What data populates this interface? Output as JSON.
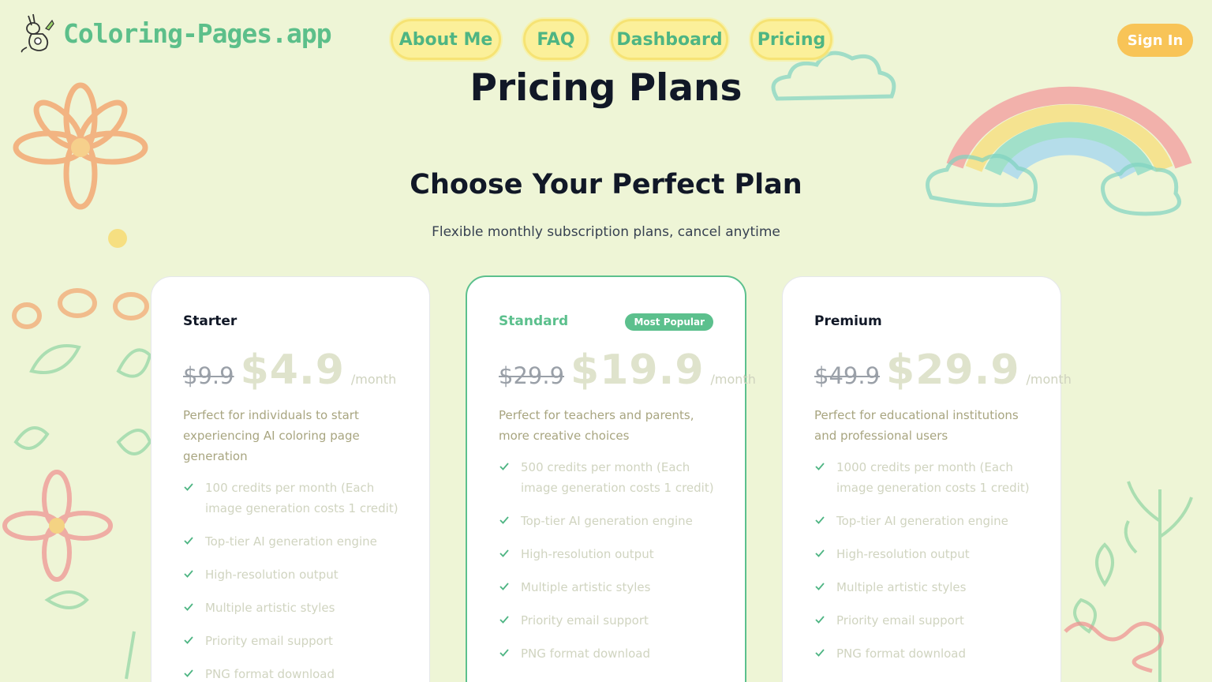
{
  "header": {
    "logo_text": "Coloring-Pages.app",
    "nav": [
      "About Me",
      "FAQ",
      "Dashboard",
      "Pricing"
    ],
    "sign_in": "Sign In"
  },
  "page_title": "Pricing Plans",
  "section": {
    "title": "Choose Your Perfect Plan",
    "subtitle": "Flexible monthly subscription plans, cancel anytime"
  },
  "plans": [
    {
      "name": "Starter",
      "old_price": "$9.9",
      "price": "$4.9",
      "period": "/month",
      "description": "Perfect for individuals to start experiencing AI coloring page generation",
      "features": [
        "100 credits per month (Each image generation costs 1 credit)",
        "Top-tier AI generation engine",
        "High-resolution output",
        "Multiple artistic styles",
        "Priority email support",
        "PNG format download"
      ]
    },
    {
      "name": "Standard",
      "badge": "Most Popular",
      "old_price": "$29.9",
      "price": "$19.9",
      "period": "/month",
      "description": "Perfect for teachers and parents, more creative choices",
      "features": [
        "500 credits per month (Each image generation costs 1 credit)",
        "Top-tier AI generation engine",
        "High-resolution output",
        "Multiple artistic styles",
        "Priority email support",
        "PNG format download"
      ]
    },
    {
      "name": "Premium",
      "old_price": "$49.9",
      "price": "$29.9",
      "period": "/month",
      "description": "Perfect for educational institutions and professional users",
      "features": [
        "1000 credits per month (Each image generation costs 1 credit)",
        "Top-tier AI generation engine",
        "High-resolution output",
        "Multiple artistic styles",
        "Priority email support",
        "PNG format download"
      ]
    }
  ],
  "icons": {
    "logo": "kangaroo-icon",
    "feature": "check-icon",
    "decorations": [
      "flower-icon",
      "rainbow-icon",
      "cloud-icon",
      "leaf-icon"
    ]
  },
  "colors": {
    "background": "#eef5d6",
    "brand_green": "#5cc08d",
    "nav_yellow": "#fbf09a",
    "sign_in_orange": "#f8c457"
  }
}
